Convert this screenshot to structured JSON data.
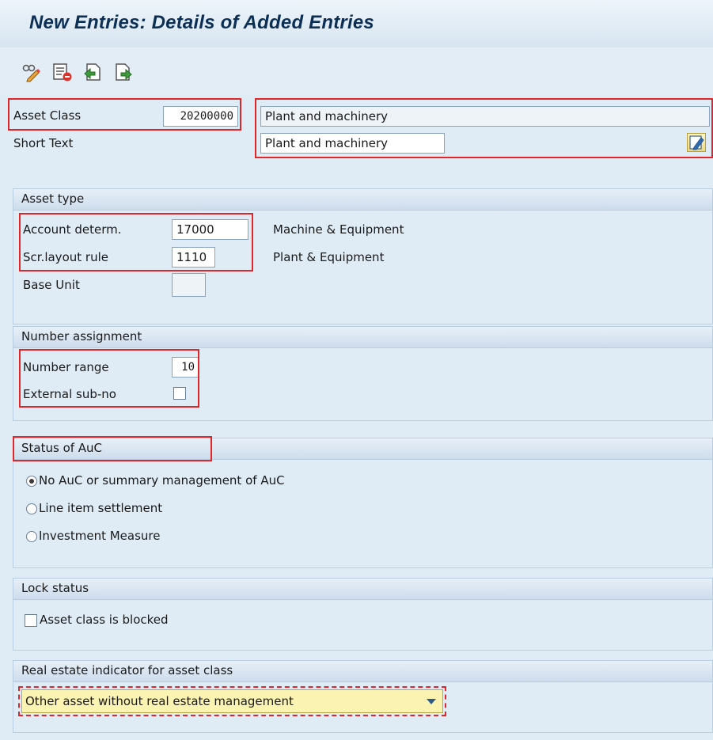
{
  "title": "New Entries: Details of Added Entries",
  "toolbar": {
    "icons": [
      "change-display-icon",
      "delete-entry-icon",
      "previous-entry-icon",
      "next-entry-icon"
    ]
  },
  "header": {
    "asset_class_label": "Asset Class",
    "asset_class_value": "20200000",
    "asset_class_desc": "Plant and machinery",
    "short_text_label": "Short Text",
    "short_text_value": "Plant and machinery"
  },
  "asset_type": {
    "title": "Asset type",
    "account_label": "Account determ.",
    "account_value": "17000",
    "account_desc": "Machine & Equipment",
    "layout_label": "Scr.layout rule",
    "layout_value": "1110",
    "layout_desc": "Plant & Equipment",
    "base_unit_label": "Base Unit",
    "base_unit_value": ""
  },
  "number_assignment": {
    "title": "Number assignment",
    "range_label": "Number range",
    "range_value": "10",
    "subno_label": "External sub-no",
    "subno_checked": false
  },
  "auc": {
    "title": "Status of AuC",
    "options": [
      {
        "label": "No AuC or summary management of AuC",
        "selected": true
      },
      {
        "label": "Line item settlement",
        "selected": false
      },
      {
        "label": "Investment Measure",
        "selected": false
      }
    ]
  },
  "lock": {
    "title": "Lock status",
    "blocked_label": "Asset class is blocked",
    "blocked_checked": false
  },
  "real_estate": {
    "title": "Real estate indicator for asset class",
    "selected": "Other asset without real estate management"
  },
  "colors": {
    "highlight": "#e0262b",
    "title_text": "#0b2f55",
    "dropdown_bg": "#fbf3b2"
  }
}
